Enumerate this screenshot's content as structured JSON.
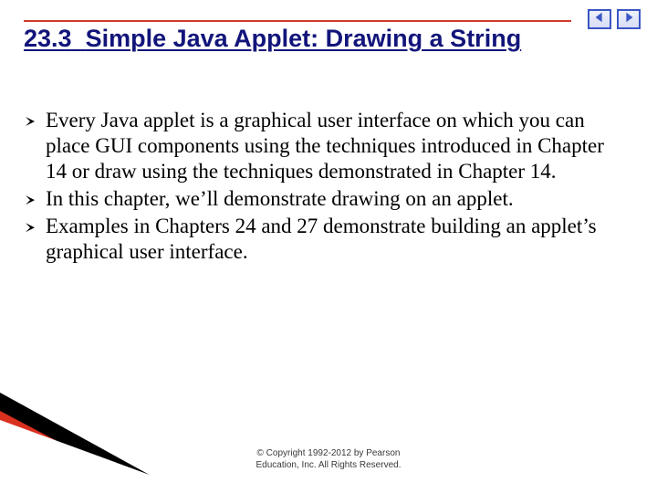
{
  "section_number": "23.3",
  "title_rest": "Simple Java Applet: Drawing a String",
  "bullets": [
    "Every Java applet is a graphical user interface on which you can place GUI components using the techniques introduced in Chapter 14 or draw using the techniques demonstrated in Chapter 14.",
    "In this chapter, we’ll demonstrate drawing on an applet.",
    "Examples in Chapters 24 and 27 demonstrate building an applet’s graphical user interface."
  ],
  "footer_line1": "© Copyright 1992-2012 by Pearson",
  "footer_line2": "Education, Inc. All Rights Reserved.",
  "nav": {
    "prev_label": "Previous slide",
    "next_label": "Next slide"
  },
  "colors": {
    "title": "#12157a",
    "rule": "#cf3a2f",
    "nav_border": "#3a55c4"
  }
}
